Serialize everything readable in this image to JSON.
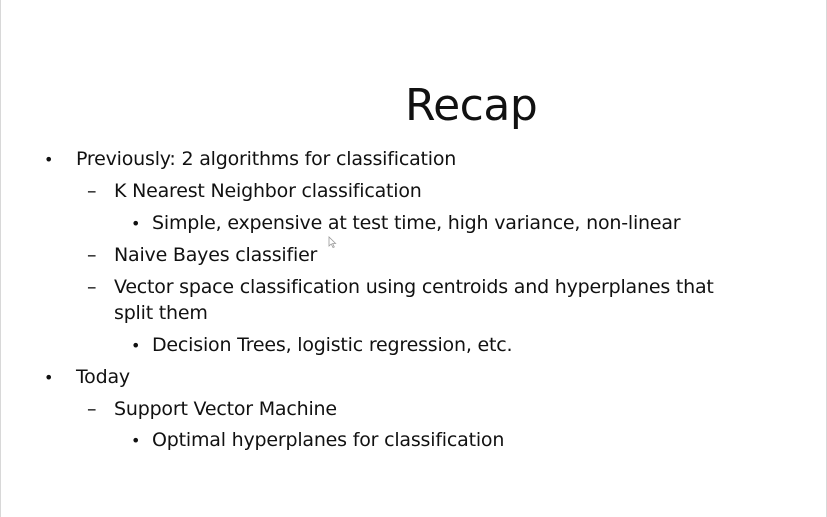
{
  "slide": {
    "title": "Recap",
    "items": [
      {
        "marker": "•",
        "text": "Previously: 2 algorithms for  classification"
      },
      {
        "marker": "–",
        "text": "K Nearest Neighbor classification"
      },
      {
        "marker": "•",
        "text": "Simple, expensive at test time, high variance, non-linear"
      },
      {
        "marker": "–",
        "text": "Naive Bayes classifier"
      },
      {
        "marker": "–",
        "text": "Vector space classification using centroids and hyperplanes that"
      },
      {
        "marker": "",
        "text": "split them"
      },
      {
        "marker": "•",
        "text": "Decision Trees, logistic regression, etc."
      },
      {
        "marker": "•",
        "text": "Today"
      },
      {
        "marker": "–",
        "text": "Support Vector Machine"
      },
      {
        "marker": "•",
        "text": "Optimal hyperplanes for classification"
      }
    ]
  }
}
